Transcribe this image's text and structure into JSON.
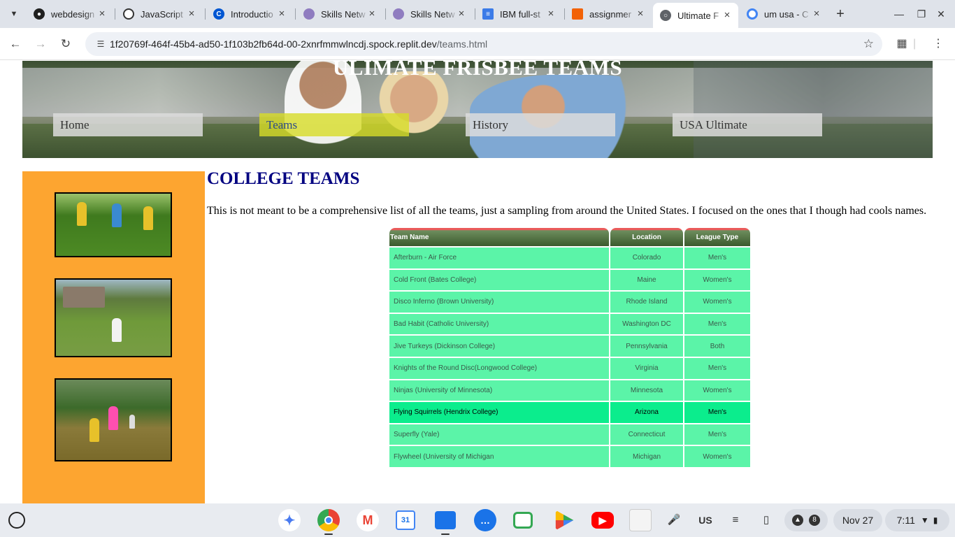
{
  "tabs": [
    {
      "title": "webdesign",
      "icon": "github-icon"
    },
    {
      "title": "JavaScript",
      "icon": "openai-icon"
    },
    {
      "title": "Introductio",
      "icon": "coursera-icon"
    },
    {
      "title": "Skills Netw",
      "icon": "skillsnetwork-icon"
    },
    {
      "title": "Skills Netw",
      "icon": "skillsnetwork-icon"
    },
    {
      "title": "IBM full-st",
      "icon": "docs-icon"
    },
    {
      "title": "assignmer",
      "icon": "replit-icon"
    },
    {
      "title": "Ultimate F",
      "icon": "globe-icon",
      "active": true
    },
    {
      "title": "um usa - C",
      "icon": "google-icon"
    }
  ],
  "address": {
    "host": "1f20769f-464f-45b4-ad50-1f103b2fb64d-00-2xnrfmmwlncdj.spock.replit.dev",
    "path": "/teams.html"
  },
  "banner": {
    "title": "ULIMATE FRISBEE TEAMS"
  },
  "nav": [
    {
      "label": "Home"
    },
    {
      "label": "Teams",
      "active": true
    },
    {
      "label": "History"
    },
    {
      "label": "USA Ultimate"
    }
  ],
  "main": {
    "heading": "COLLEGE TEAMS",
    "intro": "This is not meant to be a comprehensive list of all the teams, just a sampling from around the United States. I focused on the ones that I though had cools names."
  },
  "table": {
    "headers": [
      "Team Name",
      "Location",
      "League Type"
    ],
    "rows": [
      [
        "Afterburn - Air Force",
        "Colorado",
        "Men's"
      ],
      [
        "Cold Front (Bates College)",
        "Maine",
        "Women's"
      ],
      [
        "Disco Inferno (Brown University)",
        "Rhode Island",
        "Women's"
      ],
      [
        "Bad Habit (Catholic University)",
        "Washington DC",
        "Men's"
      ],
      [
        "Jive Turkeys (Dickinson College)",
        "Pennsylvania",
        "Both"
      ],
      [
        "Knights of the Round Disc(Longwood College)",
        "Virginia",
        "Men's"
      ],
      [
        "Ninjas (University of Minnesota)",
        "Minnesota",
        "Women's"
      ],
      [
        "Flying Squirrels (Hendrix College)",
        "Arizona",
        "Men's"
      ],
      [
        "Superfly (Yale)",
        "Connecticut",
        "Men's"
      ],
      [
        "Flywheel (University of Michigan",
        "Michigan",
        "Women's"
      ]
    ],
    "highlighted_row": 7
  },
  "shelf": {
    "apps": [
      "gemini-icon",
      "chrome-icon",
      "gmail-icon",
      "calendar-icon",
      "files-icon",
      "messages-icon",
      "meet-icon",
      "play-store-icon",
      "youtube-icon",
      "app-thumbnail-icon"
    ],
    "calendar_day": "31",
    "ime": "US",
    "notification_count": "8",
    "date": "Nov 27",
    "time": "7:11"
  },
  "colors": {
    "sidebar": "#fda530",
    "heading": "#000080",
    "row": "#5bf4a8",
    "row_highlight": "#0bed8d",
    "nav_active": "#d7dc28"
  }
}
